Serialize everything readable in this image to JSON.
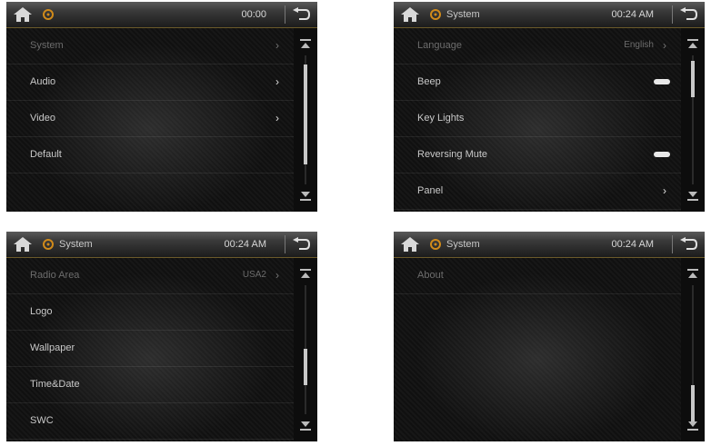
{
  "screens": [
    {
      "title": "",
      "time": "00:00",
      "rows": [
        {
          "label": "System",
          "value": "",
          "chevron": "›",
          "dim": true
        },
        {
          "label": "Audio",
          "value": "",
          "chevron": "›",
          "dim": false
        },
        {
          "label": "Video",
          "value": "",
          "chevron": "›",
          "dim": false
        },
        {
          "label": "Default",
          "value": "",
          "chevron": "",
          "dim": false
        }
      ],
      "scroll_position": 0.0
    },
    {
      "title": "System",
      "time": "00:24 AM",
      "rows": [
        {
          "label": "Language",
          "value": "English",
          "chevron": "›",
          "dim": true
        },
        {
          "label": "Beep",
          "value": "",
          "toggle": true
        },
        {
          "label": "Key Lights",
          "value": ""
        },
        {
          "label": "Reversing Mute",
          "value": "",
          "toggle": true
        },
        {
          "label": "Panel",
          "value": "",
          "chevron": "›"
        }
      ],
      "scroll_position": 0.0
    },
    {
      "title": "System",
      "time": "00:24 AM",
      "rows": [
        {
          "label": "Radio Area",
          "value": "USA2",
          "chevron": "›",
          "dim": true
        },
        {
          "label": "Logo",
          "value": ""
        },
        {
          "label": "Wallpaper",
          "value": ""
        },
        {
          "label": "Time&Date",
          "value": ""
        },
        {
          "label": "SWC",
          "value": ""
        }
      ],
      "scroll_position": 0.5
    },
    {
      "title": "System",
      "time": "00:24 AM",
      "rows": [
        {
          "label": "About",
          "value": "",
          "dim": true
        }
      ],
      "scroll_position": 1.0
    }
  ],
  "icons": {
    "home": "home-icon",
    "gear": "gear-icon",
    "back": "back-arrow-icon",
    "scroll_up": "scroll-up-icon",
    "scroll_down": "scroll-down-icon"
  },
  "colors": {
    "accent": "#d08a1a",
    "header_top": "#5a5a5a",
    "text": "#c9c9c9"
  }
}
